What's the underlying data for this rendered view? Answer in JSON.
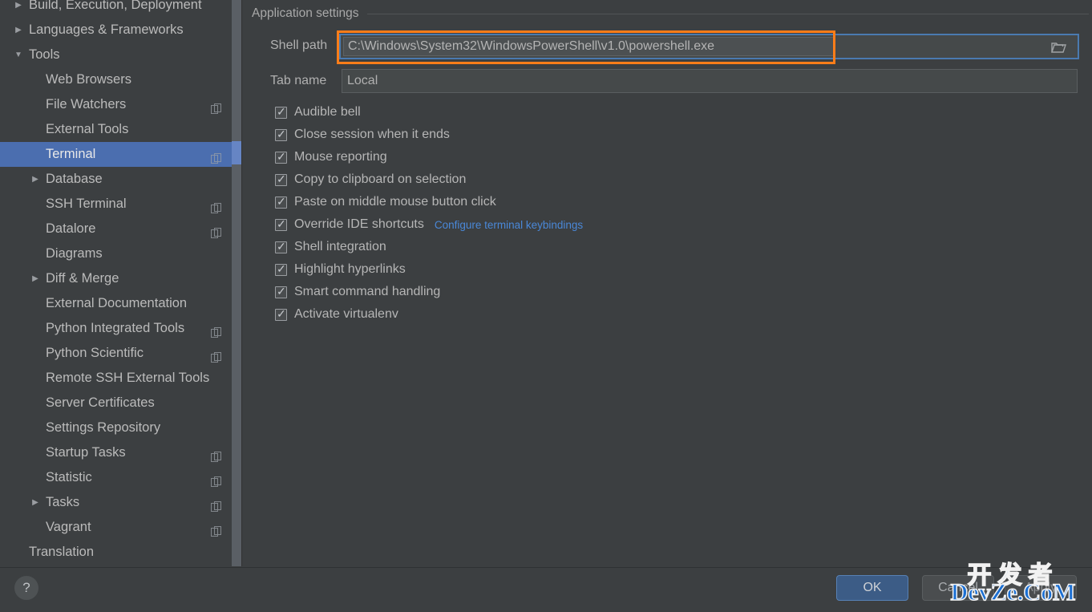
{
  "colors": {
    "background": "#3c3f41",
    "selection_blue": "#4b6eaf",
    "accent_link": "#4a88d8",
    "annotation_orange": "#ff7d19",
    "focus_border": "#4a7ab0",
    "ok_button": "#3c5c86"
  },
  "sidebar": {
    "items": [
      {
        "label": "Build, Execution, Deployment",
        "level": 0,
        "arrow": "collapsed",
        "copy_icon": false,
        "selected": false
      },
      {
        "label": "Languages & Frameworks",
        "level": 0,
        "arrow": "collapsed",
        "copy_icon": false,
        "selected": false
      },
      {
        "label": "Tools",
        "level": 0,
        "arrow": "expanded",
        "copy_icon": false,
        "selected": false
      },
      {
        "label": "Web Browsers",
        "level": 1,
        "arrow": "none",
        "copy_icon": false,
        "selected": false
      },
      {
        "label": "File Watchers",
        "level": 1,
        "arrow": "none",
        "copy_icon": true,
        "selected": false
      },
      {
        "label": "External Tools",
        "level": 1,
        "arrow": "none",
        "copy_icon": false,
        "selected": false
      },
      {
        "label": "Terminal",
        "level": 1,
        "arrow": "none",
        "copy_icon": true,
        "selected": true
      },
      {
        "label": "Database",
        "level": 1,
        "arrow": "collapsed",
        "copy_icon": false,
        "selected": false
      },
      {
        "label": "SSH Terminal",
        "level": 1,
        "arrow": "none",
        "copy_icon": true,
        "selected": false
      },
      {
        "label": "Datalore",
        "level": 1,
        "arrow": "none",
        "copy_icon": true,
        "selected": false
      },
      {
        "label": "Diagrams",
        "level": 1,
        "arrow": "none",
        "copy_icon": false,
        "selected": false
      },
      {
        "label": "Diff & Merge",
        "level": 1,
        "arrow": "collapsed",
        "copy_icon": false,
        "selected": false
      },
      {
        "label": "External Documentation",
        "level": 1,
        "arrow": "none",
        "copy_icon": false,
        "selected": false
      },
      {
        "label": "Python Integrated Tools",
        "level": 1,
        "arrow": "none",
        "copy_icon": true,
        "selected": false
      },
      {
        "label": "Python Scientific",
        "level": 1,
        "arrow": "none",
        "copy_icon": true,
        "selected": false
      },
      {
        "label": "Remote SSH External Tools",
        "level": 1,
        "arrow": "none",
        "copy_icon": false,
        "selected": false
      },
      {
        "label": "Server Certificates",
        "level": 1,
        "arrow": "none",
        "copy_icon": false,
        "selected": false
      },
      {
        "label": "Settings Repository",
        "level": 1,
        "arrow": "none",
        "copy_icon": false,
        "selected": false
      },
      {
        "label": "Startup Tasks",
        "level": 1,
        "arrow": "none",
        "copy_icon": true,
        "selected": false
      },
      {
        "label": "Statistic",
        "level": 1,
        "arrow": "none",
        "copy_icon": true,
        "selected": false
      },
      {
        "label": "Tasks",
        "level": 1,
        "arrow": "collapsed",
        "copy_icon": true,
        "selected": false
      },
      {
        "label": "Vagrant",
        "level": 1,
        "arrow": "none",
        "copy_icon": true,
        "selected": false
      },
      {
        "label": "Translation",
        "level": 0,
        "arrow": "none",
        "copy_icon": false,
        "selected": false
      }
    ]
  },
  "main": {
    "section_title": "Application settings",
    "shell_path": {
      "label": "Shell path",
      "value": "C:\\Windows\\System32\\WindowsPowerShell\\v1.0\\powershell.exe",
      "browse_icon": "folder-icon"
    },
    "tab_name": {
      "label": "Tab name",
      "value": "Local"
    },
    "checkboxes": [
      {
        "label": "Audible bell",
        "checked": true
      },
      {
        "label": "Close session when it ends",
        "checked": true
      },
      {
        "label": "Mouse reporting",
        "checked": true
      },
      {
        "label": "Copy to clipboard on selection",
        "checked": true
      },
      {
        "label": "Paste on middle mouse button click",
        "checked": true
      },
      {
        "label": "Override IDE shortcuts",
        "checked": true,
        "link": "Configure terminal keybindings"
      },
      {
        "label": "Shell integration",
        "checked": true
      },
      {
        "label": "Highlight hyperlinks",
        "checked": true
      },
      {
        "label": "Smart command handling",
        "checked": true
      },
      {
        "label": "Activate virtualenv",
        "checked": true
      }
    ]
  },
  "footer": {
    "help_label": "?",
    "ok_label": "OK",
    "cancel_label": "Cancel",
    "apply_label": "Apply"
  },
  "watermark": {
    "line1": "开发者",
    "line2": "DevZe.CoM"
  }
}
